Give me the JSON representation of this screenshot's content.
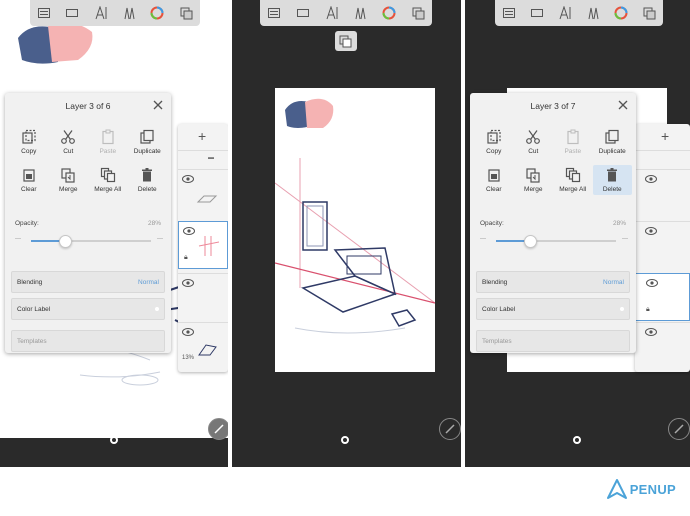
{
  "toolbar_icons": [
    "layers-icon",
    "canvas-icon",
    "text-brush-icon",
    "brush-icon",
    "color-wheel-icon",
    "layer-stack-icon"
  ],
  "panels": [
    {
      "title": "Layer 3 of 6",
      "actions": [
        {
          "label": "Copy",
          "icon": "copy-icon",
          "state": "normal"
        },
        {
          "label": "Cut",
          "icon": "scissors-icon",
          "state": "normal"
        },
        {
          "label": "Paste",
          "icon": "paste-icon",
          "state": "disabled"
        },
        {
          "label": "Duplicate",
          "icon": "duplicate-icon",
          "state": "normal"
        },
        {
          "label": "Clear",
          "icon": "clear-icon",
          "state": "normal"
        },
        {
          "label": "Merge",
          "icon": "merge-icon",
          "state": "normal"
        },
        {
          "label": "Merge All",
          "icon": "merge-all-icon",
          "state": "normal"
        },
        {
          "label": "Delete",
          "icon": "trash-icon",
          "state": "normal"
        }
      ],
      "opacity_label": "Opacity:",
      "opacity_value": "28%",
      "opacity_fraction": 0.28,
      "blending_label": "Blending",
      "blending_value": "Normal",
      "color_label": "Color Label",
      "templates_label": "Templates"
    },
    {
      "title": "Layer 3 of 7",
      "actions": [
        {
          "label": "Copy",
          "icon": "copy-icon",
          "state": "normal"
        },
        {
          "label": "Cut",
          "icon": "scissors-icon",
          "state": "normal"
        },
        {
          "label": "Paste",
          "icon": "paste-icon",
          "state": "disabled"
        },
        {
          "label": "Duplicate",
          "icon": "duplicate-icon",
          "state": "normal"
        },
        {
          "label": "Clear",
          "icon": "clear-icon",
          "state": "normal"
        },
        {
          "label": "Merge",
          "icon": "merge-icon",
          "state": "normal"
        },
        {
          "label": "Merge All",
          "icon": "merge-all-icon",
          "state": "normal"
        },
        {
          "label": "Delete",
          "icon": "trash-icon",
          "state": "selected"
        }
      ],
      "opacity_label": "Opacity:",
      "opacity_value": "28%",
      "opacity_fraction": 0.28,
      "blending_label": "Blending",
      "blending_value": "Normal",
      "color_label": "Color Label",
      "templates_label": "Templates"
    }
  ],
  "layer_strip_1": {
    "opacity_badge": "13%"
  },
  "brand": {
    "name": "PENUP",
    "color": "#4ba3d8"
  },
  "colors": {
    "accent": "#5d9bd6",
    "swatch_blue": "#4a5f8c",
    "swatch_pink": "#f5b3b3",
    "guide_red": "#d9506e",
    "sketch_navy": "#2f3a66"
  }
}
